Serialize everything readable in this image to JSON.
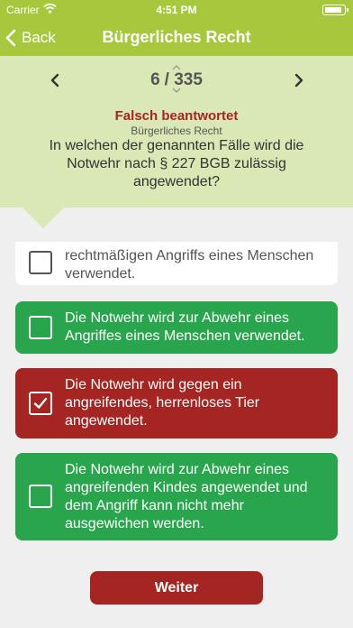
{
  "status": {
    "carrier": "Carrier",
    "time": "4:51 PM"
  },
  "nav": {
    "back_label": "Back",
    "title": "Bürgerliches Recht"
  },
  "pager": {
    "current": "6",
    "separator": "/ 335"
  },
  "question": {
    "result": "Falsch beantwortet",
    "category": "Bürgerliches Recht",
    "text": "In welchen der genannten Fälle wird die Notwehr nach § 227 BGB zulässig angewendet?"
  },
  "options": [
    {
      "text": "rechtmäßigen Angriffs eines Menschen verwendet.",
      "state": "neutral",
      "checked": false
    },
    {
      "text": "Die Notwehr wird zur Abwehr eines Angriffes eines Menschen verwendet.",
      "state": "correct",
      "checked": false
    },
    {
      "text": "Die Notwehr wird gegen ein angreifendes, herrenloses Tier angewendet.",
      "state": "wrong",
      "checked": true
    },
    {
      "text": "Die Notwehr wird zur Abwehr eines angreifenden Kindes angewendet und dem Angriff kann nicht mehr ausgewichen werden.",
      "state": "correct",
      "checked": false
    }
  ],
  "colors": {
    "accent": "#a7c83c",
    "header_bg": "#d9e8b4",
    "correct": "#29a64d",
    "wrong": "#a52523"
  },
  "next_button": {
    "label": "Weiter"
  }
}
